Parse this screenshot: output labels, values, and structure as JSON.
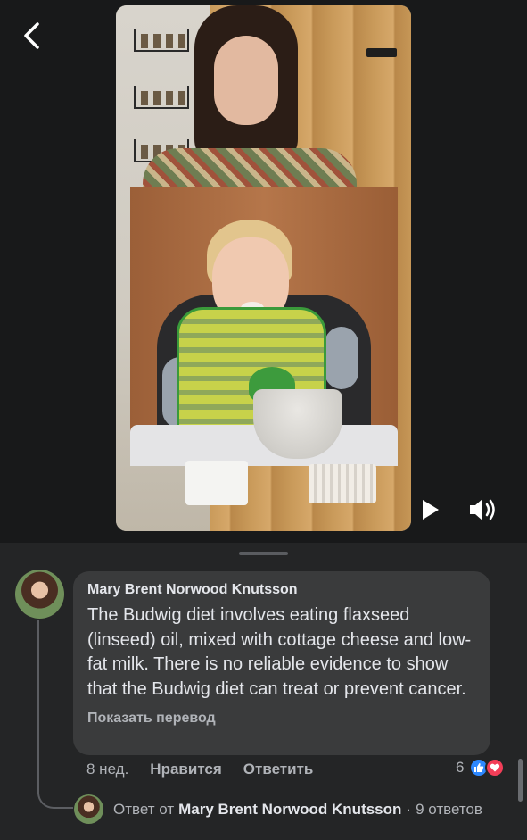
{
  "header": {
    "back_icon": "chevron-left-icon"
  },
  "video": {
    "controls": {
      "play_icon": "play-icon",
      "volume_icon": "volume-icon"
    }
  },
  "comment": {
    "author": "Mary Brent Norwood Knutsson",
    "text": "The Budwig diet involves eating flaxseed (linseed) oil, mixed with cottage cheese and low-fat milk. There is no reliable evidence to show that the Budwig diet can treat or prevent cancer.",
    "translate_label": "Показать перевод",
    "age": "8 нед.",
    "like_label": "Нравится",
    "reply_label": "Ответить",
    "reaction_count": "6",
    "reactions": [
      "like-icon",
      "love-icon"
    ]
  },
  "reply_summary": {
    "prefix": "Ответ от",
    "author": "Mary Brent Norwood Knutsson",
    "separator": "·",
    "count_label": "9 ответов"
  },
  "colors": {
    "background": "#242526",
    "bubble": "#3a3b3c",
    "text": "#e4e6eb",
    "secondary_text": "#b0b3b8",
    "like_blue": "#2d88ff",
    "love_red": "#f33e58"
  }
}
